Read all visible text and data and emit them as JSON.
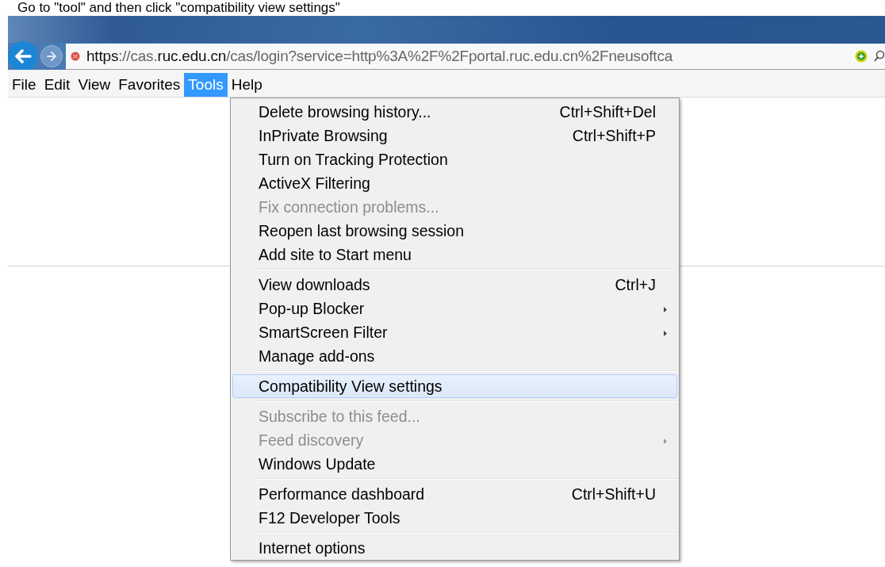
{
  "caption": "Go to \"tool\" and then click \"compatibility view settings\"",
  "address_bar": {
    "url_parts": [
      {
        "text": "https",
        "strong": true
      },
      {
        "text": "://cas.",
        "strong": false
      },
      {
        "text": "ruc.edu.cn",
        "strong": true
      },
      {
        "text": "/cas/login?service=http%3A%2F%2Fportal.ruc.edu.cn%2Fneusoftca",
        "strong": false
      }
    ]
  },
  "menu_bar": [
    {
      "label": "File",
      "selected": false
    },
    {
      "label": "Edit",
      "selected": false
    },
    {
      "label": "View",
      "selected": false
    },
    {
      "label": "Favorites",
      "selected": false
    },
    {
      "label": "Tools",
      "selected": true
    },
    {
      "label": "Help",
      "selected": false
    }
  ],
  "tools_menu": [
    {
      "kind": "item",
      "label": "Delete browsing history...",
      "shortcut": "Ctrl+Shift+Del",
      "disabled": false,
      "submenu": false,
      "selected": false
    },
    {
      "kind": "item",
      "label": "InPrivate Browsing",
      "shortcut": "Ctrl+Shift+P",
      "disabled": false,
      "submenu": false,
      "selected": false
    },
    {
      "kind": "item",
      "label": "Turn on Tracking Protection",
      "disabled": false,
      "submenu": false,
      "selected": false
    },
    {
      "kind": "item",
      "label": "ActiveX Filtering",
      "disabled": false,
      "submenu": false,
      "selected": false
    },
    {
      "kind": "item",
      "label": "Fix connection problems...",
      "disabled": true,
      "submenu": false,
      "selected": false
    },
    {
      "kind": "item",
      "label": "Reopen last browsing session",
      "disabled": false,
      "submenu": false,
      "selected": false
    },
    {
      "kind": "item",
      "label": "Add site to Start menu",
      "disabled": false,
      "submenu": false,
      "selected": false
    },
    {
      "kind": "separator"
    },
    {
      "kind": "item",
      "label": "View downloads",
      "shortcut": "Ctrl+J",
      "disabled": false,
      "submenu": false,
      "selected": false
    },
    {
      "kind": "item",
      "label": "Pop-up Blocker",
      "disabled": false,
      "submenu": true,
      "selected": false
    },
    {
      "kind": "item",
      "label": "SmartScreen Filter",
      "disabled": false,
      "submenu": true,
      "selected": false
    },
    {
      "kind": "item",
      "label": "Manage add-ons",
      "disabled": false,
      "submenu": false,
      "selected": false
    },
    {
      "kind": "separator"
    },
    {
      "kind": "item",
      "label": "Compatibility View settings",
      "disabled": false,
      "submenu": false,
      "selected": true
    },
    {
      "kind": "separator"
    },
    {
      "kind": "item",
      "label": "Subscribe to this feed...",
      "disabled": true,
      "submenu": false,
      "selected": false
    },
    {
      "kind": "item",
      "label": "Feed discovery",
      "disabled": true,
      "submenu": true,
      "selected": false
    },
    {
      "kind": "item",
      "label": "Windows Update",
      "disabled": false,
      "submenu": false,
      "selected": false
    },
    {
      "kind": "separator"
    },
    {
      "kind": "item",
      "label": "Performance dashboard",
      "shortcut": "Ctrl+Shift+U",
      "disabled": false,
      "submenu": false,
      "selected": false
    },
    {
      "kind": "item",
      "label": "F12 Developer Tools",
      "disabled": false,
      "submenu": false,
      "selected": false
    },
    {
      "kind": "separator"
    },
    {
      "kind": "item",
      "label": "Internet options",
      "disabled": false,
      "submenu": false,
      "selected": false
    }
  ]
}
